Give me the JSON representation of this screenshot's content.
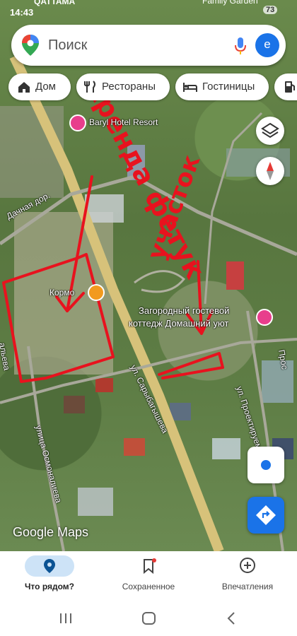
{
  "status_bar": {
    "time": "14:43",
    "carrier": "QATTAMA",
    "place": "Family Garden",
    "battery": "73"
  },
  "search": {
    "placeholder": "Поиск",
    "avatar_letter": "e"
  },
  "chips": [
    {
      "label": "Дом",
      "icon": "home-icon"
    },
    {
      "label": "Рестораны",
      "icon": "fork-knife-icon"
    },
    {
      "label": "Гостиницы",
      "icon": "hotel-icon"
    },
    {
      "label": "",
      "icon": "gas-station-icon"
    }
  ],
  "map": {
    "labels": {
      "hotel_resort": "Baryl Hotel Resort",
      "kormo": "Кормо",
      "cottage_line1": "Загородный гостевой",
      "cottage_line2": "коттедж Домашний уют",
      "street_dachnaya": "Дачная дор.",
      "street_sarybagysheva": "ул. Сарыбагышева",
      "street_osmonalieva": "улица Осмоналиева",
      "street_proektiruem": "ул. Проектируем",
      "street_alieva": "альева",
      "street_pros": "Прос",
      "google_maps": "Google Maps"
    },
    "annotations": {
      "rent_text": "Аренда фетук",
      "plot_text": "участок"
    },
    "colors": {
      "road": "#d7c27a",
      "annotation_red": "#e8121e",
      "poi_pink": "#e83e8c",
      "accent_blue": "#1a73e8"
    }
  },
  "bottom_nav": [
    {
      "label": "Что рядом?",
      "icon": "location-pin-icon",
      "active": true
    },
    {
      "label": "Сохраненное",
      "icon": "bookmark-icon",
      "active": false
    },
    {
      "label": "Впечатления",
      "icon": "add-circle-icon",
      "active": false
    }
  ]
}
